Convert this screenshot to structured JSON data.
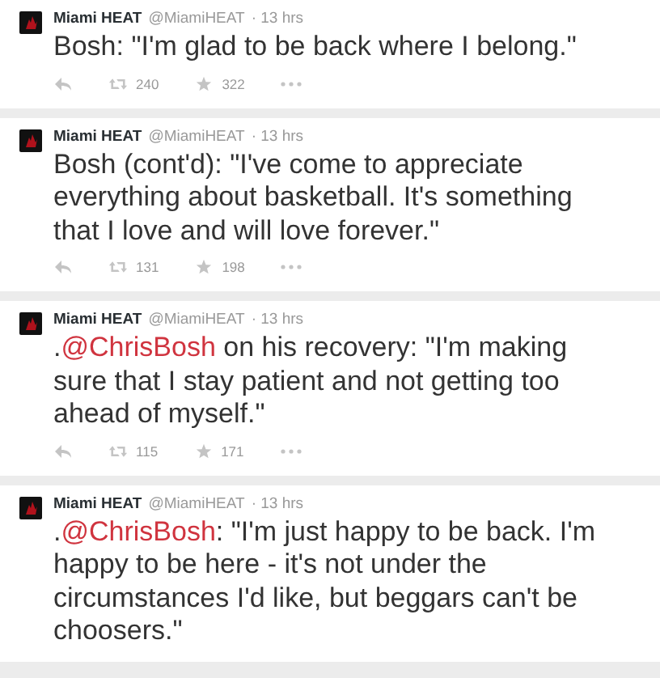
{
  "tweets": [
    {
      "name": "Miami HEAT",
      "handle": "@MiamiHEAT",
      "time": "· 13 hrs",
      "text": [
        {
          "kind": "text",
          "text": "Bosh: \"I'm glad to be back where I belong.\""
        }
      ],
      "retweets": "240",
      "favorites": "322"
    },
    {
      "name": "Miami HEAT",
      "handle": "@MiamiHEAT",
      "time": "· 13 hrs",
      "text": [
        {
          "kind": "text",
          "text": "Bosh (cont'd): \"I've come to appreciate everything about basketball. It's something that I love and will love forever.\""
        }
      ],
      "retweets": "131",
      "favorites": "198"
    },
    {
      "name": "Miami HEAT",
      "handle": "@MiamiHEAT",
      "time": "· 13 hrs",
      "text": [
        {
          "kind": "text",
          "text": "."
        },
        {
          "kind": "mention",
          "text": "@ChrisBosh"
        },
        {
          "kind": "text",
          "text": " on his recovery: \"I'm making sure that I stay patient and not getting too ahead of myself.\""
        }
      ],
      "retweets": "115",
      "favorites": "171"
    },
    {
      "name": "Miami HEAT",
      "handle": "@MiamiHEAT",
      "time": "· 13 hrs",
      "text": [
        {
          "kind": "text",
          "text": "."
        },
        {
          "kind": "mention",
          "text": "@ChrisBosh"
        },
        {
          "kind": "text",
          "text": ": \"I'm just happy to be back. I'm happy to be here - it's not under the circumstances I'd like, but beggars can't be choosers.\""
        }
      ]
    }
  ]
}
